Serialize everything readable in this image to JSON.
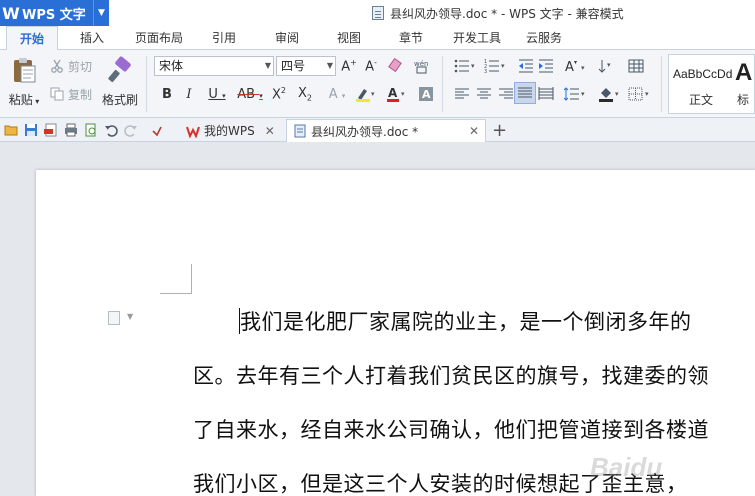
{
  "app": {
    "wps_button_label": "WPS 文字",
    "window_title": "县纠风办领导.doc * - WPS 文字 - 兼容模式"
  },
  "ribbon_tabs": [
    "开始",
    "插入",
    "页面布局",
    "引用",
    "审阅",
    "视图",
    "章节",
    "开发工具",
    "云服务"
  ],
  "clipboard": {
    "paste": "粘贴",
    "cut": "剪切",
    "copy": "复制",
    "format_painter": "格式刷"
  },
  "font": {
    "name": "宋体",
    "size": "四号"
  },
  "styles": {
    "normal_sample": "AaBbCcDd",
    "normal_label": "正文",
    "next_sample": "A",
    "next_label": "标"
  },
  "doc_tabs": {
    "home": "我的WPS",
    "current": "县纠风办领导.doc *"
  },
  "document": {
    "lines": [
      "我们是化肥厂家属院的业主，是一个倒闭多年的",
      "区。去年有三个人打着我们贫民区的旗号，找建委的领",
      "了自来水，经自来水公司确认，他们把管道接到各楼道",
      "我们小区，但是这三个人安装的时候想起了歪主意，"
    ]
  },
  "watermark": "Baidu"
}
